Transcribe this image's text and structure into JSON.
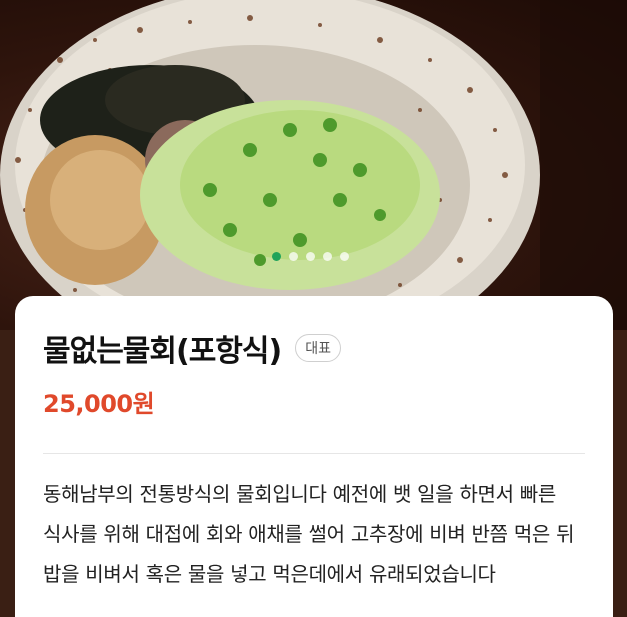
{
  "carousel": {
    "total": 5,
    "active_index": 0,
    "active_color": "#1fa35a"
  },
  "menu": {
    "name": "물없는물회(포항식)",
    "badge": "대표",
    "price": "25,000원",
    "description": "동해남부의 전통방식의 물회입니다 예전에 뱃 일을 하면서 빠른 식사를 위해 대접에 회와 애채를 썰어 고추장에 비벼 반쯤 먹은 뒤 밥을 비벼서 혹은 물을 넣고 먹은데에서 유래되었습니다"
  },
  "colors": {
    "price": "#e0492b",
    "card": "#ffffff",
    "background": "#3a1f14"
  }
}
